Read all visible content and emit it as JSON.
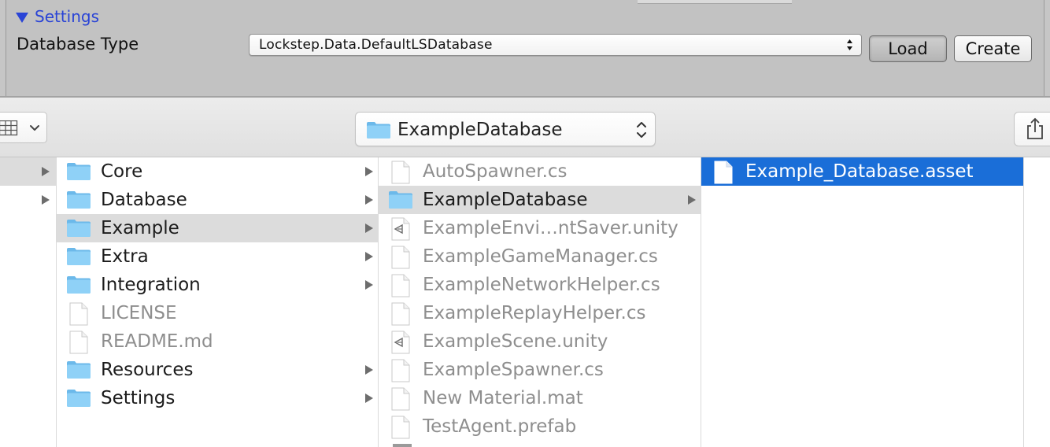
{
  "inspector": {
    "foldout_label": "Settings",
    "db_type_label": "Database Type",
    "db_type_value": "Lockstep.Data.DefaultLSDatabase",
    "load_label": "Load",
    "create_label": "Create"
  },
  "toolbar": {
    "view_icon": "column-view-icon",
    "path_label": "ExampleDatabase",
    "share_icon": "share-icon"
  },
  "columns": {
    "col1": [
      {
        "label": "Core",
        "icon": "folder-icon",
        "chevron": true,
        "selected": false
      },
      {
        "label": "Database",
        "icon": "folder-icon",
        "chevron": true,
        "selected": false
      },
      {
        "label": "Example",
        "icon": "folder-icon",
        "chevron": true,
        "selected": true
      },
      {
        "label": "Extra",
        "icon": "folder-icon",
        "chevron": true,
        "selected": false
      },
      {
        "label": "Integration",
        "icon": "folder-icon",
        "chevron": true,
        "selected": false
      },
      {
        "label": "LICENSE",
        "icon": "document-icon",
        "chevron": false,
        "selected": false
      },
      {
        "label": "README.md",
        "icon": "document-icon",
        "chevron": false,
        "selected": false
      },
      {
        "label": "Resources",
        "icon": "folder-icon",
        "chevron": true,
        "selected": false
      },
      {
        "label": "Settings",
        "icon": "folder-icon",
        "chevron": true,
        "selected": false
      }
    ],
    "col2": [
      {
        "label": "AutoSpawner.cs",
        "icon": "document-icon",
        "chevron": false,
        "selected": false
      },
      {
        "label": "ExampleDatabase",
        "icon": "folder-icon",
        "chevron": true,
        "selected": true
      },
      {
        "label": "ExampleEnvi…ntSaver.unity",
        "icon": "unity-scene-icon",
        "chevron": false,
        "selected": false
      },
      {
        "label": "ExampleGameManager.cs",
        "icon": "document-icon",
        "chevron": false,
        "selected": false
      },
      {
        "label": "ExampleNetworkHelper.cs",
        "icon": "document-icon",
        "chevron": false,
        "selected": false
      },
      {
        "label": "ExampleReplayHelper.cs",
        "icon": "document-icon",
        "chevron": false,
        "selected": false
      },
      {
        "label": "ExampleScene.unity",
        "icon": "unity-scene-icon",
        "chevron": false,
        "selected": false
      },
      {
        "label": "ExampleSpawner.cs",
        "icon": "document-icon",
        "chevron": false,
        "selected": false
      },
      {
        "label": "New Material.mat",
        "icon": "document-icon",
        "chevron": false,
        "selected": false
      },
      {
        "label": "TestAgent.prefab",
        "icon": "document-icon",
        "chevron": false,
        "selected": false
      }
    ],
    "col3": [
      {
        "label": "Example_Database.asset",
        "icon": "document-icon",
        "chevron": false,
        "selected": true
      }
    ]
  },
  "colors": {
    "selection_blue": "#1a6ed8",
    "selection_gray": "#dcdcdc",
    "folder_blue": "#79c8f4",
    "unity_link_blue": "#2a44d6"
  }
}
